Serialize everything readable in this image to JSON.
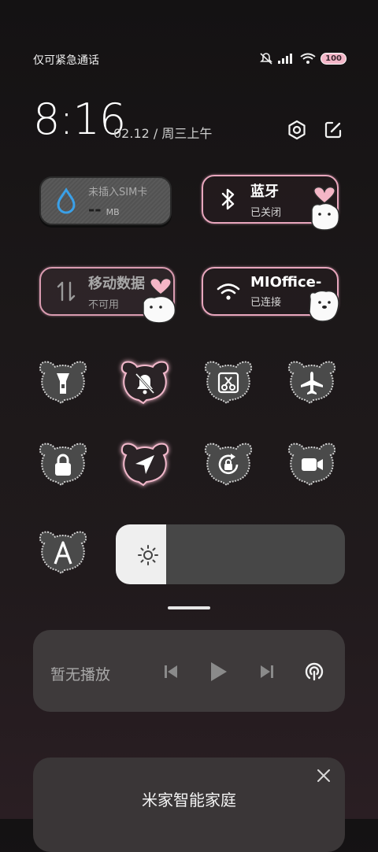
{
  "status_bar": {
    "carrier": "仅可紧急通话",
    "battery_level": 100,
    "battery_text": "100"
  },
  "header": {
    "time": "8:16",
    "date": "02.12 / 周三上午",
    "icons": [
      "settings-icon",
      "edit-icon"
    ]
  },
  "tiles": {
    "sim": {
      "title": "未插入SIM卡",
      "value": "--",
      "unit": "MB",
      "icon": "water-drop-icon"
    },
    "bluetooth": {
      "title": "蓝牙",
      "status": "已关闭",
      "icon": "bluetooth-icon"
    },
    "mobile_data": {
      "title": "移动数据",
      "status": "不可用",
      "icon": "data-arrows-icon"
    },
    "wifi": {
      "title": "MIOffice-",
      "status": "已连接",
      "icon": "wifi-icon"
    }
  },
  "toggles": [
    {
      "name": "flashlight",
      "icon": "flashlight-icon",
      "active": false
    },
    {
      "name": "silent",
      "icon": "bell-off-icon",
      "active": true
    },
    {
      "name": "screenshot",
      "icon": "scissors-icon",
      "active": false
    },
    {
      "name": "airplane",
      "icon": "airplane-icon",
      "active": false
    },
    {
      "name": "lock",
      "icon": "lock-icon",
      "active": false
    },
    {
      "name": "location",
      "icon": "location-arrow-icon",
      "active": true
    },
    {
      "name": "rotation-lock",
      "icon": "rotation-lock-icon",
      "active": false
    },
    {
      "name": "screen-record",
      "icon": "video-camera-icon",
      "active": false
    },
    {
      "name": "font-size",
      "icon": "letter-a-icon",
      "active": false
    }
  ],
  "brightness": {
    "level": 0.22,
    "icon": "sun-icon"
  },
  "media": {
    "label": "暂无播放",
    "icons": [
      "previous-icon",
      "play-icon",
      "next-icon",
      "cast-icon"
    ]
  },
  "smart_home": {
    "title": "米家智能家庭"
  },
  "colors": {
    "accent_pink": "#e8a6bd",
    "background": "#1c1819",
    "sim_drop": "#3aa0e8"
  }
}
